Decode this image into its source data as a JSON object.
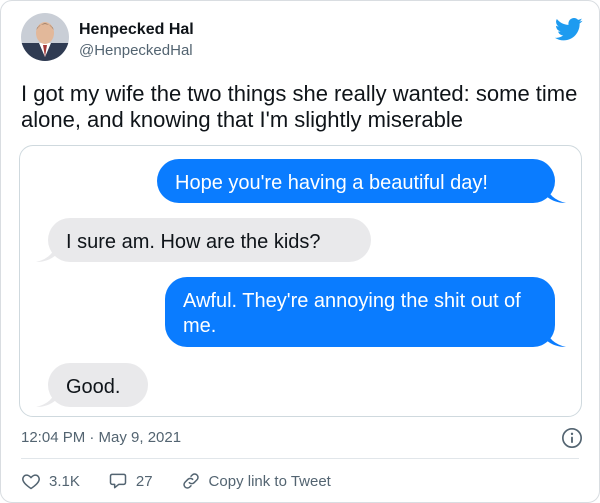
{
  "author": {
    "name": "Henpecked Hal",
    "handle": "@HenpeckedHal"
  },
  "tweet": {
    "text": "I got my wife the two things she really wanted: some time alone, and knowing that I'm slightly miserable",
    "timestamp": "12:04 PM · May 9, 2021"
  },
  "conversation": {
    "messages": [
      {
        "sender": "me",
        "text": "Hope you're having a beautiful day!"
      },
      {
        "sender": "wife",
        "text": "I sure am. How are the kids?"
      },
      {
        "sender": "me",
        "text": "Awful. They're annoying the shit out of me."
      },
      {
        "sender": "wife",
        "text": "Good."
      }
    ]
  },
  "actions": {
    "likes": "3.1K",
    "replies": "27",
    "copy_link": "Copy link to Tweet"
  },
  "icons": {
    "brand": "twitter-bird-icon",
    "info": "info-icon",
    "like": "heart-icon",
    "reply": "reply-icon",
    "link": "link-icon"
  },
  "colors": {
    "twitter_blue": "#1d9bf0",
    "imessage_blue": "#0a7cff",
    "imessage_gray": "#e9e9eb",
    "secondary_text": "#536471"
  }
}
